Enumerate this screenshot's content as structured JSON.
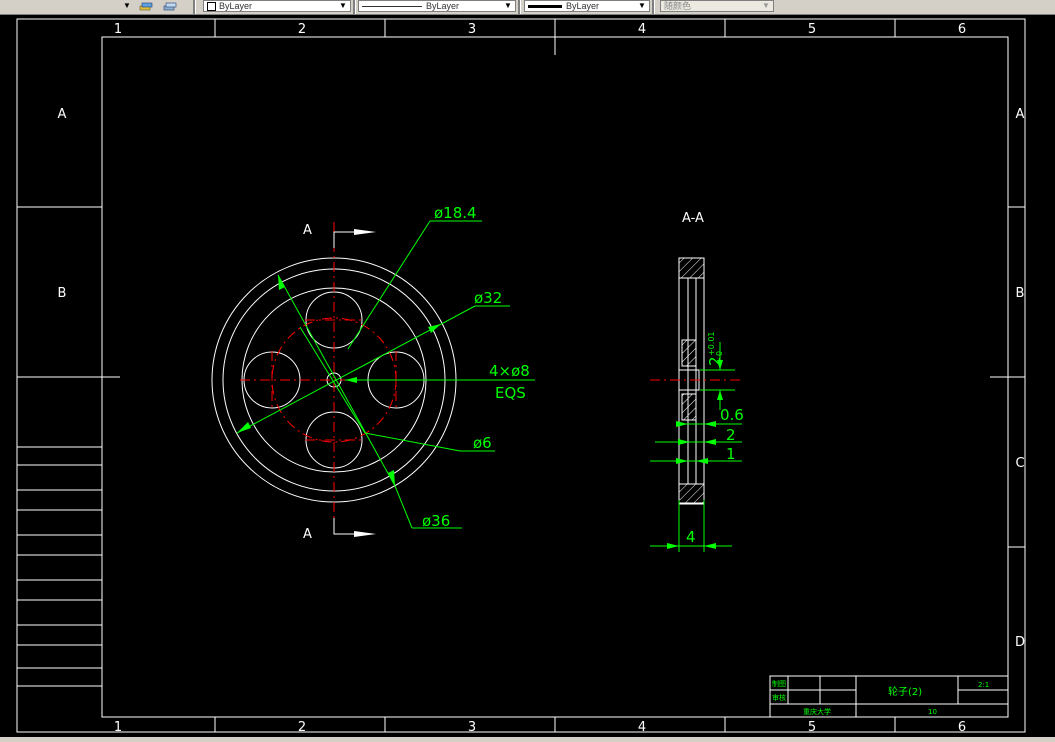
{
  "toolbar": {
    "layer_dropdown_arrow": "▼",
    "color_value": "ByLayer",
    "linetype_value": "ByLayer",
    "lineweight_value": "ByLayer",
    "plotstyle_value": "随颜色"
  },
  "frame": {
    "col_labels": [
      "1",
      "2",
      "3",
      "4",
      "5",
      "6"
    ],
    "row_labels": [
      "A",
      "B",
      "C",
      "D"
    ]
  },
  "front_view": {
    "section_mark": "A",
    "dims": {
      "d18": "ø18.4",
      "d32": "ø32",
      "holes_line1": "4×ø8",
      "holes_line2": "EQS",
      "d6": "ø6",
      "d36": "ø36"
    }
  },
  "section_view": {
    "title": "A-A",
    "dims": {
      "bore": "2",
      "tol_upper": "+0.01",
      "tol_lower": "0",
      "d06": "0.6",
      "d2": "2",
      "d1": "1",
      "d4": "4"
    }
  },
  "title_block": {
    "drawn_label": "制图",
    "check_label": "审核",
    "part_name": "轮子(2)",
    "scale": "2:1",
    "school": "重庆大学",
    "quantity": "10"
  },
  "colors": {
    "frame": "#ffffff",
    "dimension": "#00ff00",
    "center": "#ff0000"
  }
}
